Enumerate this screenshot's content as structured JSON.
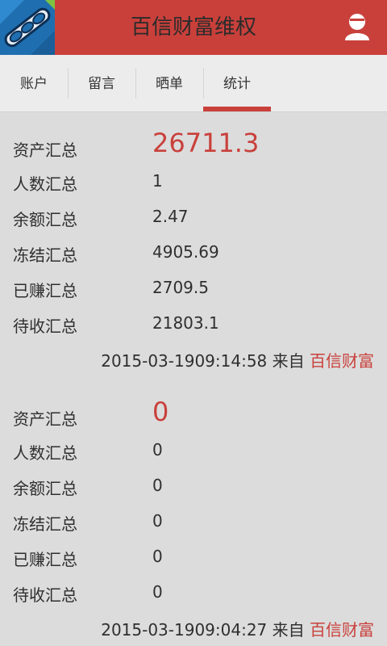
{
  "app": {
    "title": "百信财富维权"
  },
  "icons": {
    "logo": "chain-logo-icon",
    "user": "user-icon"
  },
  "colors": {
    "brand": "#c9403b"
  },
  "tabs": [
    {
      "label": "账户",
      "active": false
    },
    {
      "label": "留言",
      "active": false
    },
    {
      "label": "晒单",
      "active": false
    },
    {
      "label": "统计",
      "active": true
    }
  ],
  "records": [
    {
      "rows": [
        {
          "label": "资产汇总",
          "value": "26711.3"
        },
        {
          "label": "人数汇总",
          "value": "1"
        },
        {
          "label": "余额汇总",
          "value": "2.47"
        },
        {
          "label": "冻结汇总",
          "value": "4905.69"
        },
        {
          "label": "已赚汇总",
          "value": "2709.5"
        },
        {
          "label": "待收汇总",
          "value": "21803.1"
        }
      ],
      "timestamp": "2015-03-1909:14:58",
      "from_label": "来自",
      "source": "百信财富"
    },
    {
      "rows": [
        {
          "label": "资产汇总",
          "value": "0"
        },
        {
          "label": "人数汇总",
          "value": "0"
        },
        {
          "label": "余额汇总",
          "value": "0"
        },
        {
          "label": "冻结汇总",
          "value": "0"
        },
        {
          "label": "已赚汇总",
          "value": "0"
        },
        {
          "label": "待收汇总",
          "value": "0"
        }
      ],
      "timestamp": "2015-03-1909:04:27",
      "from_label": "来自",
      "source": "百信财富"
    }
  ]
}
